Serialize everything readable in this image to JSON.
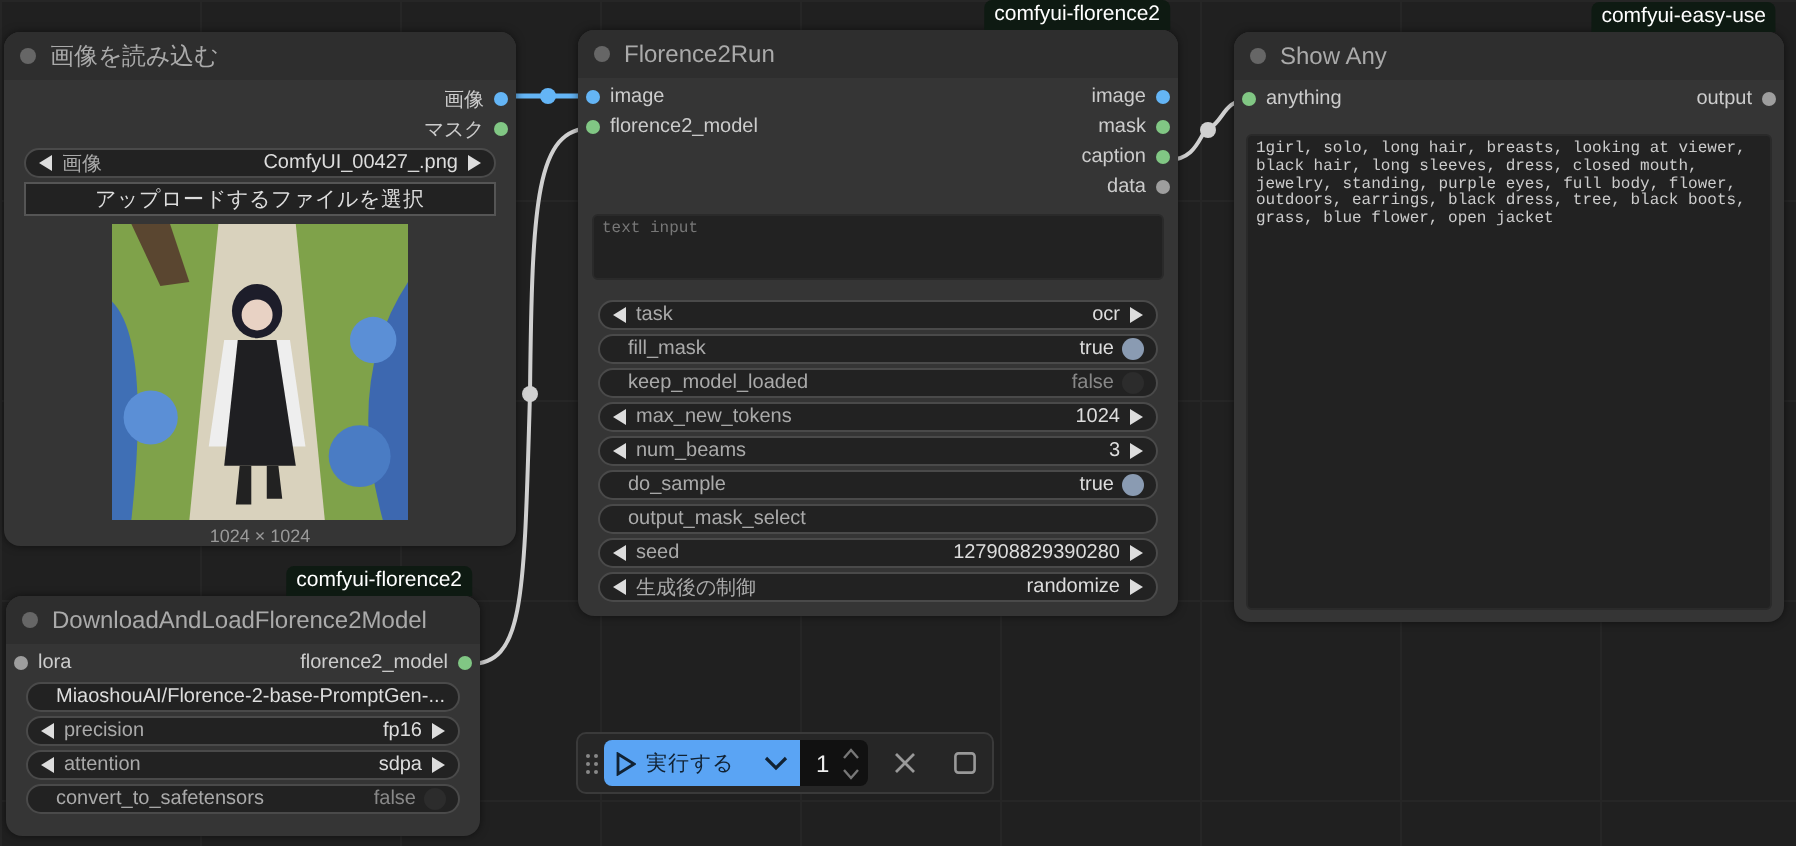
{
  "nodes": [
    {
      "kind": "load_image",
      "title": "画像を読み込む",
      "outputs": [
        {
          "label": "画像",
          "color": "#64b5f6"
        },
        {
          "label": "マスク",
          "color": "#81c784"
        }
      ],
      "widgets": [
        {
          "kind": "combo",
          "label": "画像",
          "value": "ComfyUI_00427_.png"
        },
        {
          "kind": "button",
          "label": "アップロードするファイルを選択"
        }
      ],
      "preview": {
        "caption": "1024 × 1024"
      }
    },
    {
      "kind": "florence_run",
      "badge": "comfyui-florence2",
      "title": "Florence2Run",
      "inputs": [
        {
          "label": "image",
          "color": "#64b5f6"
        },
        {
          "label": "florence2_model",
          "color": "#81c784"
        }
      ],
      "outputs": [
        {
          "label": "image",
          "color": "#64b5f6"
        },
        {
          "label": "mask",
          "color": "#81c784"
        },
        {
          "label": "caption",
          "color": "#81c784"
        },
        {
          "label": "data",
          "color": "#9e9e9e"
        }
      ],
      "text": {
        "placeholder": "text input"
      },
      "widgets": [
        {
          "kind": "combo",
          "label": "task",
          "value": "ocr"
        },
        {
          "kind": "toggle",
          "label": "fill_mask",
          "value": "true",
          "on": true
        },
        {
          "kind": "toggle",
          "label": "keep_model_loaded",
          "value": "false",
          "on": false
        },
        {
          "kind": "number",
          "label": "max_new_tokens",
          "value": "1024"
        },
        {
          "kind": "number",
          "label": "num_beams",
          "value": "3"
        },
        {
          "kind": "toggle",
          "label": "do_sample",
          "value": "true",
          "on": true
        },
        {
          "kind": "text",
          "label": "output_mask_select"
        },
        {
          "kind": "number",
          "label": "seed",
          "value": "127908829390280"
        },
        {
          "kind": "combo",
          "label": "生成後の制御",
          "value": "randomize"
        }
      ]
    },
    {
      "kind": "show_any",
      "badge": "comfyui-easy-use",
      "title": "Show Any",
      "inputs": [
        {
          "label": "anything",
          "color": "#81c784"
        }
      ],
      "outputs": [
        {
          "label": "output",
          "color": "#9e9e9e"
        }
      ],
      "text": {
        "value": "1girl, solo, long hair, breasts, looking at viewer, black hair, long sleeves, dress, closed mouth, jewelry, standing, purple eyes, full body, flower, outdoors, earrings, black dress, tree, black boots, grass, blue flower, open jacket"
      }
    },
    {
      "kind": "download_model",
      "badge": "comfyui-florence2",
      "title": "DownloadAndLoadFlorence2Model",
      "inputs": [
        {
          "label": "lora",
          "color": "#9e9e9e"
        }
      ],
      "outputs": [
        {
          "label": "florence2_model",
          "color": "#81c784"
        }
      ],
      "widgets": [
        {
          "kind": "combo",
          "value": "MiaoshouAI/Florence-2-base-PromptGen-..."
        },
        {
          "kind": "combo",
          "label": "precision",
          "value": "fp16"
        },
        {
          "kind": "combo",
          "label": "attention",
          "value": "sdpa"
        },
        {
          "kind": "toggle",
          "label": "convert_to_safetensors",
          "value": "false",
          "on": false
        }
      ]
    }
  ],
  "toolbar": {
    "run_label": "実行する",
    "count": "1"
  }
}
